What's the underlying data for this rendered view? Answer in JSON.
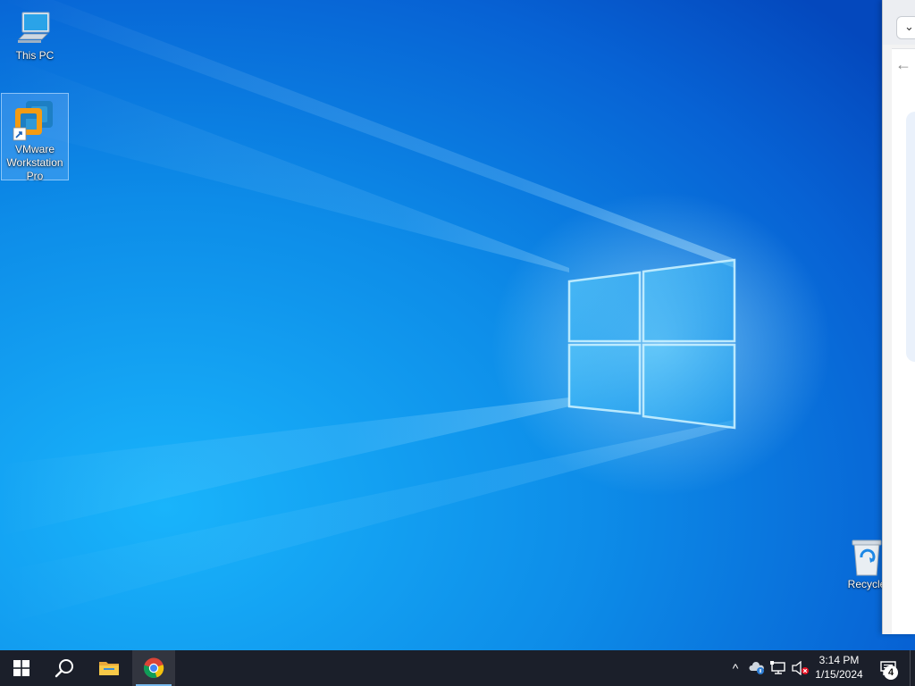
{
  "desktop": {
    "icons": [
      {
        "label": "This PC",
        "icon": "this-pc-icon"
      },
      {
        "label_line1": "VMware",
        "label_line2": "Workstation",
        "label_line3": "Pro",
        "icon": "vmware-workstation-icon",
        "selected": true
      },
      {
        "label": "Recycle",
        "icon": "recycle-bin-icon"
      }
    ],
    "wallpaper": "windows-10-hero",
    "colors": {
      "wallpaper_base": "#0a6fd8",
      "wallpaper_light": "#16a9f5",
      "taskbar": "#1b1f2a"
    }
  },
  "taskbar": {
    "pinned": [
      {
        "name": "start",
        "icon": "windows-logo-icon"
      },
      {
        "name": "search",
        "icon": "search-icon"
      },
      {
        "name": "file-explorer",
        "icon": "folder-icon"
      },
      {
        "name": "chrome",
        "icon": "chrome-icon",
        "active": true
      }
    ],
    "tray": {
      "chevron": "^",
      "clock_time": "3:14 PM",
      "clock_date": "1/15/2024",
      "notification_count": "4"
    }
  },
  "side_window": {
    "dropdown": "⌄",
    "back": "←"
  }
}
